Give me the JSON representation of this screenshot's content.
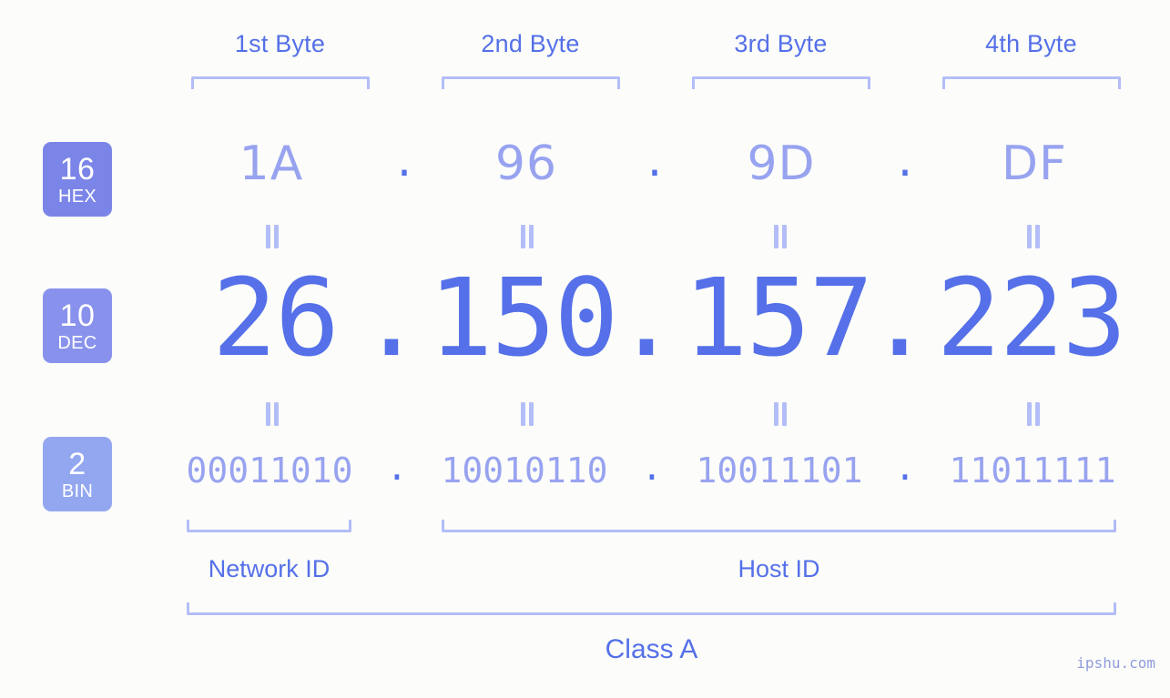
{
  "meta": {
    "background_color": "#fcfdfa",
    "accent_color": "#5570e8",
    "light_accent_color": "#98a3f0",
    "bracket_color": "#b3bdf7"
  },
  "byte_headers": [
    {
      "label": "1st Byte"
    },
    {
      "label": "2nd Byte"
    },
    {
      "label": "3rd Byte"
    },
    {
      "label": "4th Byte"
    }
  ],
  "systems": [
    {
      "base": "16",
      "name": "HEX",
      "color": "#7b85e8"
    },
    {
      "base": "10",
      "name": "DEC",
      "color": "#8892ec"
    },
    {
      "base": "2",
      "name": "BIN",
      "color": "#93a7f0"
    }
  ],
  "separator": ".",
  "equals_symbol": "||",
  "rows": {
    "hex": {
      "values": [
        "1A",
        "96",
        "9D",
        "DF"
      ]
    },
    "dec": {
      "values": [
        "26",
        "150",
        "157",
        "223"
      ]
    },
    "bin": {
      "values": [
        "00011010",
        "10010110",
        "10011101",
        "11011111"
      ]
    }
  },
  "sections": [
    {
      "label": "Network ID"
    },
    {
      "label": "Host ID"
    }
  ],
  "class": {
    "label": "Class A"
  },
  "watermark": {
    "text": "ipshu.com"
  }
}
